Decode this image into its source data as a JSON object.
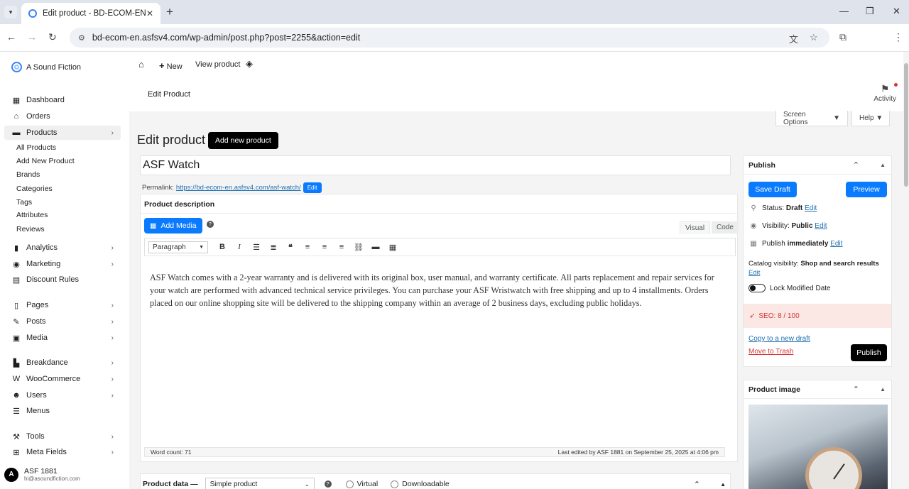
{
  "browser": {
    "tab_title": "Edit product - BD-ECOM-EN",
    "url": "bd-ecom-en.asfsv4.com/wp-admin/post.php?post=2255&action=edit"
  },
  "sidebar": {
    "brand": "A Sound Fiction",
    "items": [
      {
        "label": "Dashboard",
        "icon": "dashboard-icon"
      },
      {
        "label": "Orders",
        "icon": "inbox-icon"
      },
      {
        "label": "Products",
        "icon": "archive-icon"
      },
      {
        "label": "Analytics",
        "icon": "bar-chart-icon"
      },
      {
        "label": "Marketing",
        "icon": "megaphone-icon"
      },
      {
        "label": "Discount Rules",
        "icon": "table-icon"
      },
      {
        "label": "Pages",
        "icon": "page-icon"
      },
      {
        "label": "Posts",
        "icon": "pencil-icon"
      },
      {
        "label": "Media",
        "icon": "media-icon"
      },
      {
        "label": "Breakdance",
        "icon": "breakdance-icon"
      },
      {
        "label": "WooCommerce",
        "icon": "woo-icon"
      },
      {
        "label": "Users",
        "icon": "users-icon"
      },
      {
        "label": "Menus",
        "icon": "menu-icon"
      },
      {
        "label": "Tools",
        "icon": "wrench-icon"
      },
      {
        "label": "Meta Fields",
        "icon": "grid-icon"
      }
    ],
    "sub_items": [
      "All Products",
      "Add New Product",
      "Brands",
      "Categories",
      "Tags",
      "Attributes",
      "Reviews"
    ],
    "user": {
      "name": "ASF 1881",
      "email": "hi@asoundfiction.com",
      "initial": "A"
    }
  },
  "adminbar": {
    "new_label": "New",
    "view_label": "View product"
  },
  "header": {
    "title": "Edit Product",
    "activity_label": "Activity"
  },
  "screen_options": "Screen Options",
  "help": "Help",
  "page": {
    "title": "Edit product",
    "add_new": "Add new product",
    "product_title": "ASF Watch",
    "permalink_label": "Permalink:",
    "permalink_url": "https://bd-ecom-en.asfsv4.com/asf-watch/",
    "permalink_edit": "Edit"
  },
  "editor": {
    "section_label": "Product description",
    "add_media": "Add Media",
    "tab_visual": "Visual",
    "tab_code": "Code",
    "format": "Paragraph",
    "text": "ASF Watch comes with a 2-year warranty and is delivered with its original box, user manual, and warranty certificate. All parts replacement and repair services for your watch are performed with advanced technical service privileges. You can purchase your ASF Wristwatch with free shipping and up to 4 installments. Orders placed on our online shopping site will be delivered to the shipping company within an average of 2 business days, excluding public holidays.",
    "word_count": "Word count: 71",
    "last_edited": "Last edited by ASF 1881 on September 25, 2025 at 4:06 pm"
  },
  "product_data": {
    "label": "Product data —",
    "type": "Simple product",
    "virtual": "Virtual",
    "downloadable": "Downloadable"
  },
  "publish": {
    "title": "Publish",
    "save_draft": "Save Draft",
    "preview": "Preview",
    "status_label": "Status:",
    "status_value": "Draft",
    "visibility_label": "Visibility:",
    "visibility_value": "Public",
    "publish_label": "Publish",
    "publish_value": "immediately",
    "edit": "Edit",
    "catalog_label": "Catalog visibility:",
    "catalog_value": "Shop and search results",
    "lock_label": "Lock Modified Date",
    "seo": "SEO: 8 / 100",
    "copy_draft": "Copy to a new draft",
    "trash": "Move to Trash",
    "publish_btn": "Publish"
  },
  "product_image": {
    "title": "Product image"
  }
}
